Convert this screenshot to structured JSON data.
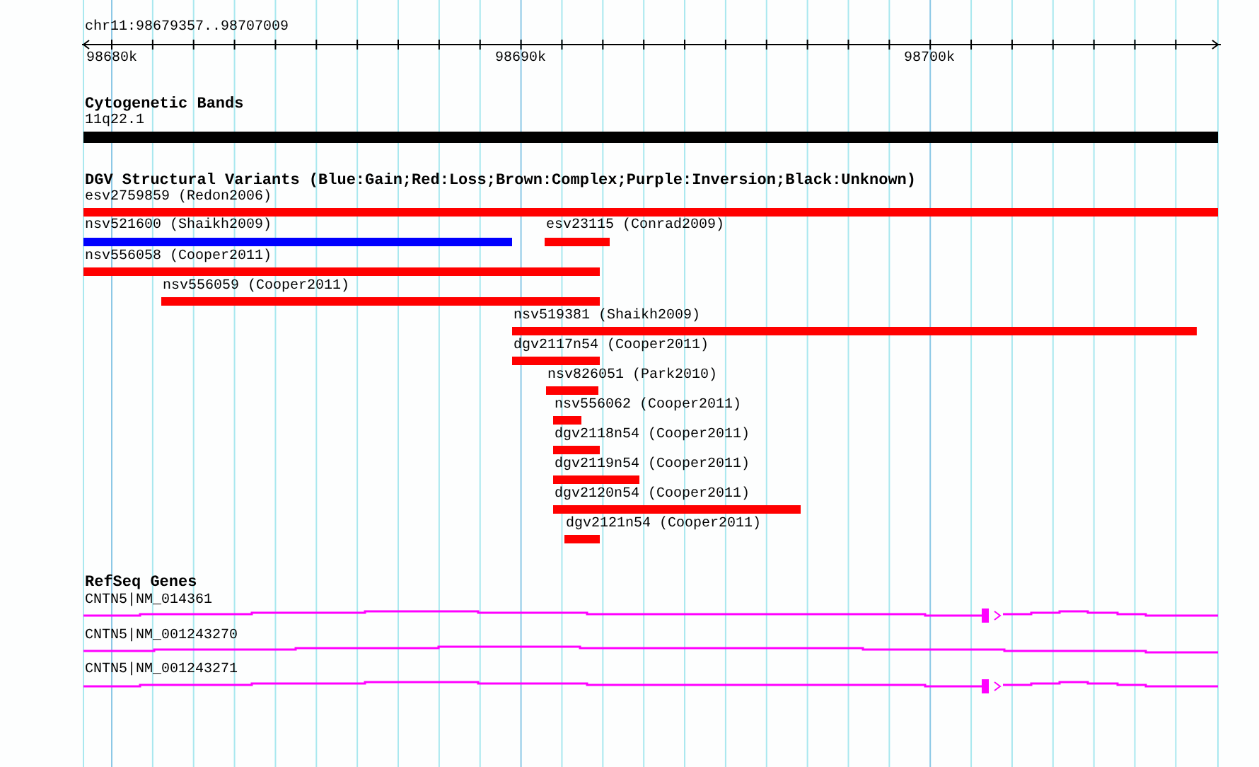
{
  "location": "chr11:98679357..98707009",
  "ruler": {
    "ticks": [
      "98680k",
      "98690k",
      "98700k"
    ]
  },
  "tracks": [
    {
      "kind": "bands",
      "title": "Cytogenetic Bands",
      "features": [
        {
          "label": "11q22.1"
        }
      ]
    },
    {
      "kind": "variants",
      "title": "DGV Structural Variants (Blue:Gain;Red:Loss;Brown:Complex;Purple:Inversion;Black:Unknown)",
      "features": [
        {
          "label": "esv2759859 (Redon2006)",
          "color": "#ff0000"
        },
        {
          "label": "nsv521600 (Shaikh2009)",
          "color": "#0000ff"
        },
        {
          "label": "esv23115 (Conrad2009)",
          "color": "#ff0000"
        },
        {
          "label": "nsv556058 (Cooper2011)",
          "color": "#ff0000"
        },
        {
          "label": "nsv556059 (Cooper2011)",
          "color": "#ff0000"
        },
        {
          "label": "nsv519381 (Shaikh2009)",
          "color": "#ff0000"
        },
        {
          "label": "dgv2117n54 (Cooper2011)",
          "color": "#ff0000"
        },
        {
          "label": "nsv826051 (Park2010)",
          "color": "#ff0000"
        },
        {
          "label": "nsv556062 (Cooper2011)",
          "color": "#ff0000"
        },
        {
          "label": "dgv2118n54 (Cooper2011)",
          "color": "#ff0000"
        },
        {
          "label": "dgv2119n54 (Cooper2011)",
          "color": "#ff0000"
        },
        {
          "label": "dgv2120n54 (Cooper2011)",
          "color": "#ff0000"
        },
        {
          "label": "dgv2121n54 (Cooper2011)",
          "color": "#ff0000"
        }
      ]
    },
    {
      "kind": "genes",
      "title": "RefSeq Genes",
      "features": [
        {
          "label": "CNTN5|NM_014361"
        },
        {
          "label": "CNTN5|NM_001243270"
        },
        {
          "label": "CNTN5|NM_001243271"
        }
      ]
    }
  ]
}
